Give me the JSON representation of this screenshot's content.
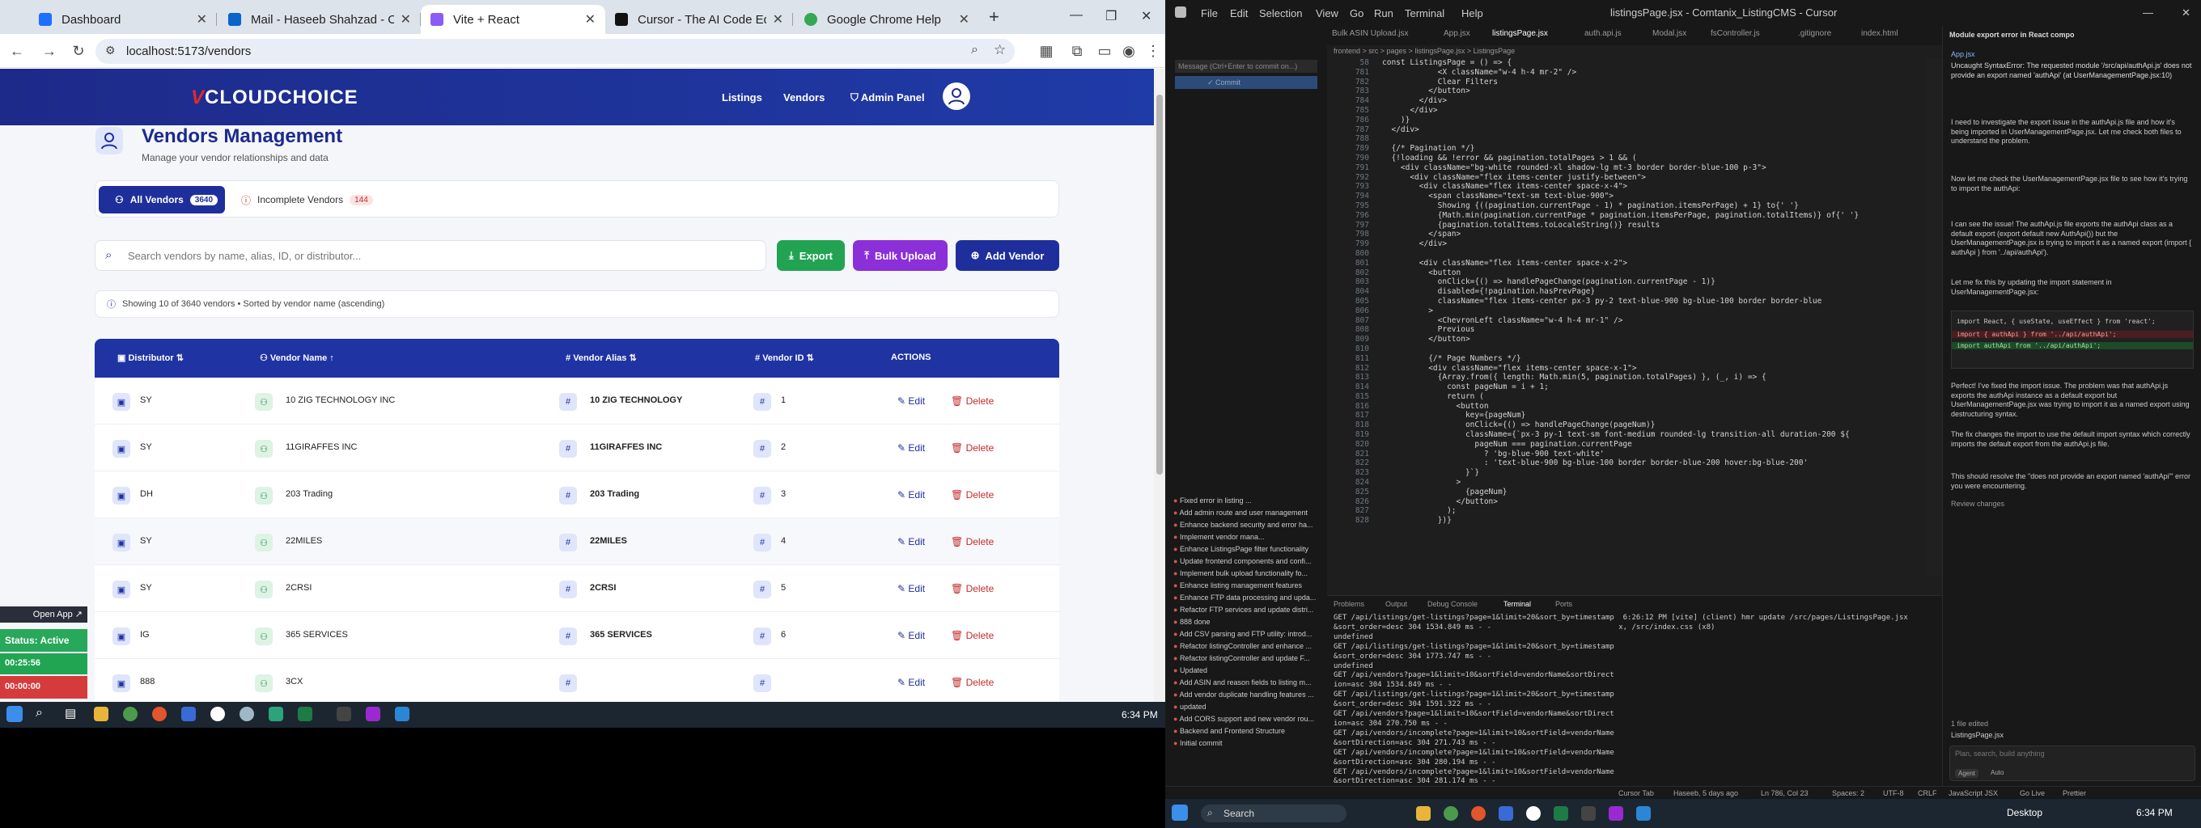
{
  "chrome": {
    "tabs": [
      {
        "label": "Dashboard",
        "color": "#1e6fff"
      },
      {
        "label": "Mail - Haseeb Shahzad - Outlo",
        "color": "#0a64c9"
      },
      {
        "label": "Vite + React",
        "color": "#8b5cf6"
      },
      {
        "label": "Cursor - The AI Code Editor",
        "color": "#111111"
      },
      {
        "label": "Google Chrome Help",
        "color": "#34a853"
      }
    ],
    "new_tab": "+",
    "url": "localhost:5173/vendors"
  },
  "app": {
    "logo_v": "V",
    "logo_text": "CLOUDCHOICE",
    "nav": [
      "Listings",
      "Vendors",
      "Admin Panel"
    ],
    "title": "Vendors Management",
    "subtitle": "Manage your vendor relationships and data",
    "tabs": {
      "all_label": "All Vendors",
      "all_count": "3640",
      "incomplete_label": "Incomplete Vendors",
      "incomplete_count": "144"
    },
    "search_placeholder": "Search vendors by name, alias, ID, or distributor...",
    "buttons": {
      "export": "Export",
      "bulk_upload": "Bulk Upload",
      "add_vendor": "Add Vendor"
    },
    "info": "Showing 10 of 3640 vendors • Sorted by vendor name (ascending)",
    "columns": [
      "Distributor",
      "Vendor Name",
      "Vendor Alias",
      "Vendor ID",
      "ACTIONS"
    ],
    "edit_label": "Edit",
    "delete_label": "Delete",
    "rows": [
      {
        "dist": "SY",
        "name": "10 ZIG TECHNOLOGY INC",
        "alias": "10 ZIG TECHNOLOGY",
        "id": "1"
      },
      {
        "dist": "SY",
        "name": "11GIRAFFES INC",
        "alias": "11GIRAFFES INC",
        "id": "2"
      },
      {
        "dist": "DH",
        "name": "203 Trading",
        "alias": "203 Trading",
        "id": "3"
      },
      {
        "dist": "SY",
        "name": "22MILES",
        "alias": "22MILES",
        "id": "4"
      },
      {
        "dist": "SY",
        "name": "2CRSI",
        "alias": "2CRSI",
        "id": "5"
      },
      {
        "dist": "IG",
        "name": "365 SERVICES",
        "alias": "365 SERVICES",
        "id": "6"
      },
      {
        "dist": "888",
        "name": "3CX",
        "alias": "",
        "id": ""
      }
    ]
  },
  "overlay": {
    "open_app": "Open App",
    "status": "Status: Active",
    "time1": "00:25:56",
    "time2": "00:00:00"
  },
  "taskbar_left": {
    "time": "6:34 PM"
  },
  "vscode": {
    "menus": [
      "File",
      "Edit",
      "Selection",
      "View",
      "Go",
      "Run",
      "Terminal",
      "Help"
    ],
    "window_title": "listingsPage.jsx - Comtanix_ListingCMS - Cursor",
    "editor_tabs": [
      "Bulk ASIN Upload.jsx",
      "App.jsx",
      "listingsPage.jsx",
      "auth.api.js",
      "Modal.jsx",
      "fsController.js",
      ".gitignore",
      "index.html"
    ],
    "breadcrumb": "frontend > src > pages > listingsPage.jsx > ListingsPage",
    "code_lines": [
      {
        "n": "58",
        "t": "const ListingsPage = () => {"
      },
      {
        "n": "781",
        "t": "            <X className=\"w-4 h-4 mr-2\" />"
      },
      {
        "n": "782",
        "t": "            Clear Filters"
      },
      {
        "n": "783",
        "t": "          </button>"
      },
      {
        "n": "784",
        "t": "        </div>"
      },
      {
        "n": "785",
        "t": "      </div>"
      },
      {
        "n": "786",
        "t": "    )}"
      },
      {
        "n": "787",
        "t": "  </div>"
      },
      {
        "n": "788",
        "t": ""
      },
      {
        "n": "789",
        "t": "  {/* Pagination */}"
      },
      {
        "n": "790",
        "t": "  {!loading && !error && pagination.totalPages > 1 && ("
      },
      {
        "n": "791",
        "t": "    <div className=\"bg-white rounded-xl shadow-lg mt-3 border border-blue-100 p-3\">"
      },
      {
        "n": "792",
        "t": "      <div className=\"flex items-center justify-between\">"
      },
      {
        "n": "793",
        "t": "        <div className=\"flex items-center space-x-4\">"
      },
      {
        "n": "794",
        "t": "          <span className=\"text-sm text-blue-900\">"
      },
      {
        "n": "795",
        "t": "            Showing {((pagination.currentPage - 1) * pagination.itemsPerPage) + 1} to{' '}"
      },
      {
        "n": "796",
        "t": "            {Math.min(pagination.currentPage * pagination.itemsPerPage, pagination.totalItems)} of{' '}"
      },
      {
        "n": "797",
        "t": "            {pagination.totalItems.toLocaleString()} results"
      },
      {
        "n": "798",
        "t": "          </span>"
      },
      {
        "n": "799",
        "t": "        </div>"
      },
      {
        "n": "800",
        "t": ""
      },
      {
        "n": "801",
        "t": "        <div className=\"flex items-center space-x-2\">"
      },
      {
        "n": "802",
        "t": "          <button"
      },
      {
        "n": "803",
        "t": "            onClick={() => handlePageChange(pagination.currentPage - 1)}"
      },
      {
        "n": "804",
        "t": "            disabled={!pagination.hasPrevPage}"
      },
      {
        "n": "805",
        "t": "            className=\"flex items-center px-3 py-2 text-blue-900 bg-blue-100 border border-blue"
      },
      {
        "n": "806",
        "t": "          >"
      },
      {
        "n": "807",
        "t": "            <ChevronLeft className=\"w-4 h-4 mr-1\" />"
      },
      {
        "n": "808",
        "t": "            Previous"
      },
      {
        "n": "809",
        "t": "          </button>"
      },
      {
        "n": "810",
        "t": ""
      },
      {
        "n": "811",
        "t": "          {/* Page Numbers */}"
      },
      {
        "n": "812",
        "t": "          <div className=\"flex items-center space-x-1\">"
      },
      {
        "n": "813",
        "t": "            {Array.from({ length: Math.min(5, pagination.totalPages) }, (_, i) => {"
      },
      {
        "n": "814",
        "t": "              const pageNum = i + 1;"
      },
      {
        "n": "815",
        "t": "              return ("
      },
      {
        "n": "816",
        "t": "                <button"
      },
      {
        "n": "817",
        "t": "                  key={pageNum}"
      },
      {
        "n": "818",
        "t": "                  onClick={() => handlePageChange(pageNum)}"
      },
      {
        "n": "819",
        "t": "                  className={`px-3 py-1 text-sm font-medium rounded-lg transition-all duration-200 ${"
      },
      {
        "n": "820",
        "t": "                    pageNum === pagination.currentPage"
      },
      {
        "n": "821",
        "t": "                      ? 'bg-blue-900 text-white'"
      },
      {
        "n": "822",
        "t": "                      : 'text-blue-900 bg-blue-100 border border-blue-200 hover:bg-blue-200'"
      },
      {
        "n": "823",
        "t": "                  }`}"
      },
      {
        "n": "824",
        "t": "                >"
      },
      {
        "n": "825",
        "t": "                  {pageNum}"
      },
      {
        "n": "826",
        "t": "                </button>"
      },
      {
        "n": "827",
        "t": "              );"
      },
      {
        "n": "828",
        "t": "            })}"
      }
    ],
    "panel_tabs": [
      "Problems",
      "Output",
      "Debug Console",
      "Terminal",
      "Ports"
    ],
    "terminal_lines": [
      "GET /api/listings/get-listings?page=1&limit=20&sort_by=timestamp  6:26:12 PM [vite] (client) hmr update /src/pages/ListingsPage.jsx",
      "&sort_order=desc 304 1534.849 ms - -                             x, /src/index.css (x8)",
      "undefined",
      "GET /api/listings/get-listings?page=1&limit=20&sort_by=timestamp",
      "&sort_order=desc 304 1773.747 ms - -",
      "undefined",
      "GET /api/vendors?page=1&limit=10&sortField=vendorName&sortDirect",
      "ion=asc 304 1534.849 ms - -",
      "GET /api/listings/get-listings?page=1&limit=20&sort_by=timestamp",
      "&sort_order=desc 304 1591.322 ms - -",
      "GET /api/vendors?page=1&limit=10&sortField=vendorName&sortDirect",
      "ion=asc 304 270.750 ms - -",
      "GET /api/vendors/incomplete?page=1&limit=10&sortField=vendorName",
      "&sortDirection=asc 304 271.743 ms - -",
      "GET /api/vendors/incomplete?page=1&limit=10&sortField=vendorName",
      "&sortDirection=asc 304 280.194 ms - -",
      "GET /api/vendors/incomplete?page=1&limit=10&sortField=vendorName",
      "&sortDirection=asc 304 281.174 ms - -"
    ],
    "agents": [
      "Fixed error in listing ...",
      "Add admin route and user management",
      "Enhance backend security and error ha...",
      "Implement vendor mana...",
      "Enhance ListingsPage filter functionality",
      "Update frontend components and confi...",
      "Implement bulk upload functionality fo...",
      "Enhance listing management features",
      "Enhance FTP data processing and upda...",
      "Refactor FTP services and update distri...",
      "888 done",
      "Add CSV parsing and FTP utility: introd...",
      "Refactor listingController and enhance ...",
      "Refactor listingController and update F...",
      "Updated",
      "Add ASIN and reason fields to listing m...",
      "Add vendor duplicate handling features ...",
      "updated",
      "Add CORS support and new vendor rou...",
      "Backend and Frontend Structure",
      "Initial commit"
    ],
    "chat": {
      "header": "Module export error in React compo",
      "err_label": "App.jsx",
      "err_text": "Uncaught SyntaxError: The requested module '/src/api/authApi.js' does not provide an export named 'authApi' (at UserManagementPage.jsx:10)",
      "p1": "I need to investigate the export issue in the authApi.js file and how it's being imported in UserManagementPage.jsx. Let me check both files to understand the problem.",
      "p2": "Now let me check the UserManagementPage.jsx file to see how it's trying to import the authApi:",
      "p3": "I can see the issue! The authApi.js file exports the authApi class as a default export (export default new AuthApi()) but the UserManagementPage.jsx is trying to import it as a named export (import { authApi } from '../api/authApi').",
      "p4": "Let me fix this by updating the import statement in UserManagementPage.jsx:",
      "code1": "import React, { useState, useEffect } from 'react';",
      "code2": "import { authApi } from '../api/authApi';",
      "code3": "import authApi from '../api/authApi';",
      "p5": "Perfect! I've fixed the import issue. The problem was that authApi.js exports the authApi instance as a default export but UserManagementPage.jsx was trying to import it as a named export using destructuring syntax.",
      "p6": "The fix changes the import to use the default import syntax which correctly imports the default export from the authApi.js file.",
      "p7": "This should resolve the \"does not provide an export named 'authApi'\" error you were encountering.",
      "review": "Review changes",
      "edited": "1 file edited",
      "file": "ListingsPage.jsx",
      "input_ph": "Plan, search, build anything",
      "mode": "Agent",
      "model": "Auto"
    },
    "status_items": [
      "Cursor Tab",
      "Haseeb, 5 days ago",
      "Ln 786, Col 23",
      "Spaces: 2",
      "UTF-8",
      "CRLF",
      "JavaScript JSX",
      "Go Live",
      "Prettier"
    ],
    "taskbar_search": "Search",
    "desktop_label": "Desktop",
    "time": "6:34 PM"
  }
}
